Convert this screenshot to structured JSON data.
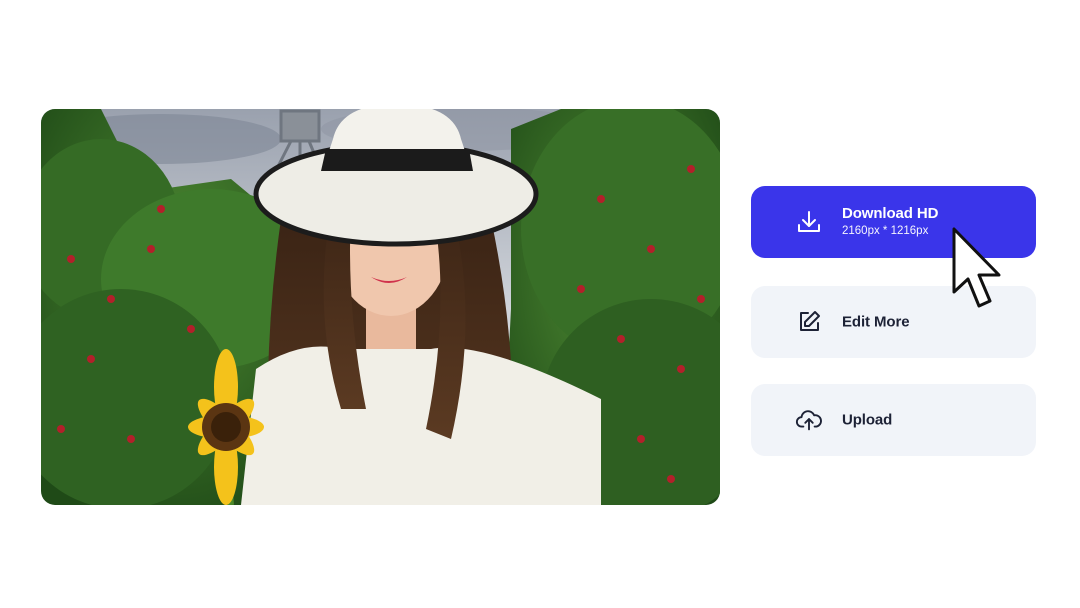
{
  "preview": {
    "description_icon": "image-preview"
  },
  "actions": {
    "download": {
      "label": "Download HD",
      "resolution": "2160px * 1216px",
      "icon": "download-icon",
      "color": "#3a35ea"
    },
    "edit": {
      "label": "Edit More",
      "icon": "edit-icon",
      "color": "#f1f4f9"
    },
    "upload": {
      "label": "Upload",
      "icon": "cloud-upload-icon",
      "color": "#f1f4f9"
    }
  },
  "cursor": {
    "icon": "arrow-cursor-icon"
  }
}
